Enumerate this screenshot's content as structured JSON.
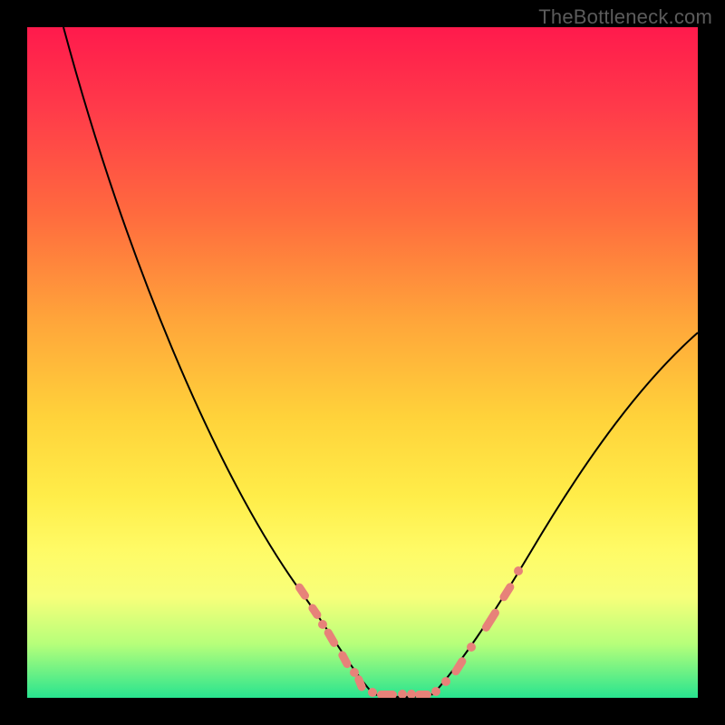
{
  "watermark": "TheBottleneck.com",
  "chart_data": {
    "type": "line",
    "title": "",
    "xlabel": "",
    "ylabel": "",
    "xlim": [
      0,
      100
    ],
    "ylim": [
      0,
      100
    ],
    "grid": false,
    "legend": false,
    "background_gradient": {
      "top": "#ff1a4c",
      "middle": "#ffd23a",
      "bottom": "#28e48f"
    },
    "series": [
      {
        "name": "bottleneck_curve",
        "x": [
          5,
          12,
          20,
          28,
          35,
          41,
          46,
          50,
          53,
          56,
          60,
          62,
          68,
          75,
          82,
          90,
          100
        ],
        "y": [
          100,
          75,
          55,
          40,
          28,
          18,
          10,
          4,
          1,
          0,
          1,
          4,
          12,
          23,
          35,
          46,
          55
        ],
        "stroke": "#000000"
      }
    ],
    "markers": {
      "name": "highlighted_points",
      "color": "#e78279",
      "shape": "capsule_and_dot",
      "x": [
        41,
        43,
        44,
        46,
        48,
        49,
        50,
        52,
        54,
        56,
        57,
        58,
        60,
        62,
        64,
        67,
        69,
        71,
        73
      ],
      "y": [
        17,
        14,
        11,
        9,
        7,
        5,
        3,
        1,
        0,
        0,
        0,
        1,
        2,
        4,
        8,
        13,
        16,
        18,
        19
      ]
    },
    "note": "No axis ticks or numeric labels are rendered in the source image; x and y values are normalized 0-100 estimates of pixel position within the plot area. Curve depicts a steep left descent to a flat minimum near x≈55, then a shallower rise to the right. Salmon capsule/dot markers cluster along the lower portion of the curve (roughly x 41–73)."
  }
}
